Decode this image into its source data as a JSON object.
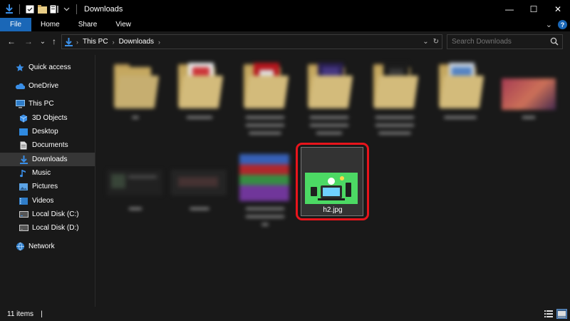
{
  "window": {
    "title": "Downloads",
    "minimize_glyph": "—",
    "maximize_glyph": "☐",
    "close_glyph": "✕"
  },
  "ribbon": {
    "tabs": [
      "File",
      "Home",
      "Share",
      "View"
    ],
    "collapse_glyph": "⌄",
    "help_glyph": "?"
  },
  "nav": {
    "back_glyph": "←",
    "forward_glyph": "→",
    "recent_glyph": "⌄",
    "up_glyph": "↑",
    "breadcrumb": [
      "This PC",
      "Downloads"
    ],
    "crumb_sep": "›",
    "dropdown_glyph": "⌄",
    "refresh_glyph": "↻"
  },
  "search": {
    "placeholder": "Search Downloads"
  },
  "sidebar": {
    "items": [
      {
        "label": "Quick access",
        "icon": "star-icon"
      },
      {
        "label": "OneDrive",
        "icon": "cloud-icon"
      },
      {
        "label": "This PC",
        "icon": "computer-icon"
      },
      {
        "label": "3D Objects",
        "icon": "cube-icon"
      },
      {
        "label": "Desktop",
        "icon": "desktop-icon"
      },
      {
        "label": "Documents",
        "icon": "document-icon"
      },
      {
        "label": "Downloads",
        "icon": "download-icon",
        "selected": true
      },
      {
        "label": "Music",
        "icon": "music-icon"
      },
      {
        "label": "Pictures",
        "icon": "pictures-icon"
      },
      {
        "label": "Videos",
        "icon": "video-icon"
      },
      {
        "label": "Local Disk (C:)",
        "icon": "drive-icon"
      },
      {
        "label": "Local Disk (D:)",
        "icon": "drive-icon"
      },
      {
        "label": "Network",
        "icon": "network-icon"
      }
    ]
  },
  "files": {
    "selected": {
      "name": "h2.jpg"
    }
  },
  "status": {
    "item_count": "11 items",
    "separator": "|"
  },
  "colors": {
    "accent": "#1a67b7",
    "highlight": "#e8141c",
    "thumb_green": "#4cd964"
  }
}
